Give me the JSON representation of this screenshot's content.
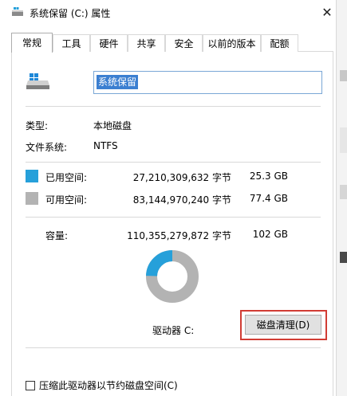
{
  "window": {
    "title": "系统保留 (C:) 属性",
    "close_glyph": "✕"
  },
  "tabs": [
    {
      "label": "常规"
    },
    {
      "label": "工具"
    },
    {
      "label": "硬件"
    },
    {
      "label": "共享"
    },
    {
      "label": "安全"
    },
    {
      "label": "以前的版本"
    },
    {
      "label": "配额"
    }
  ],
  "active_tab": "常规",
  "drive": {
    "icon": "drive-icon",
    "name_value": "系统保留"
  },
  "info": {
    "type_label": "类型:",
    "type_value": "本地磁盘",
    "fs_label": "文件系统:",
    "fs_value": "NTFS"
  },
  "space": {
    "used_label": "已用空间:",
    "used_bytes": "27,210,309,632 字节",
    "used_size": "25.3 GB",
    "used_color": "#26a0da",
    "free_label": "可用空间:",
    "free_bytes": "83,144,970,240 字节",
    "free_size": "77.4 GB",
    "free_color": "#b3b3b3",
    "capacity_label": "容量:",
    "capacity_bytes": "110,355,279,872 字节",
    "capacity_size": "102 GB",
    "used_fraction": 0.2466
  },
  "drive_label": "驱动器 C:",
  "cleanup_button": "磁盘清理(D)",
  "compress_checkbox": {
    "label": "压缩此驱动器以节约磁盘空间(C)",
    "checked": false
  }
}
